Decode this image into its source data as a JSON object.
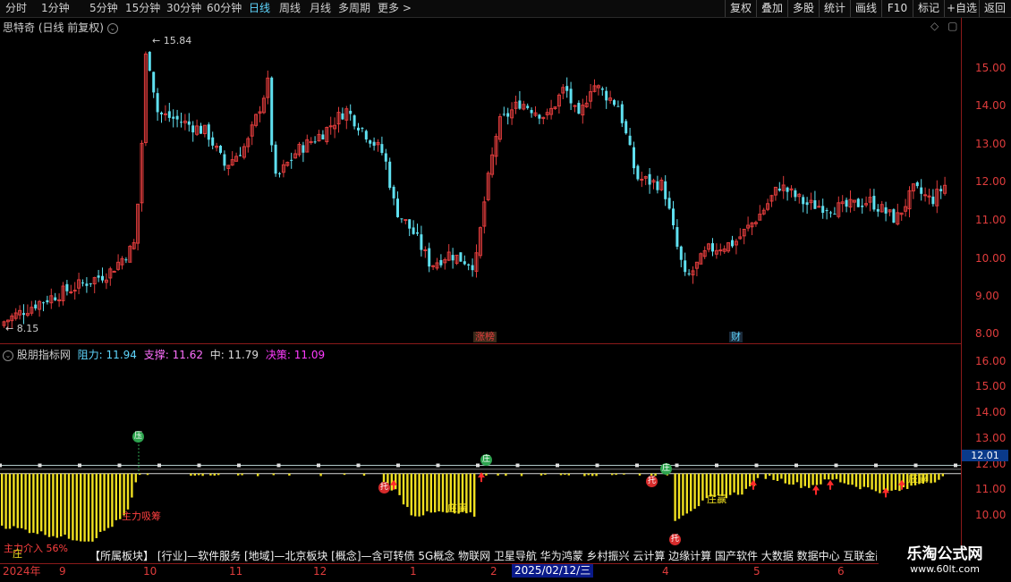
{
  "toolbar": {
    "timeframes": [
      "分时",
      "1分钟",
      "5分钟",
      "15分钟",
      "30分钟",
      "60分钟",
      "日线",
      "周线",
      "月线",
      "多周期",
      "更多 >"
    ],
    "active": "日线",
    "right_buttons": [
      "复权",
      "叠加",
      "多股",
      "统计",
      "画线",
      "F10",
      "标记",
      "+自选",
      "返回"
    ]
  },
  "price_panel": {
    "title": "思特奇 (日线 前复权)",
    "high_label": "15.84",
    "low_label": "8.15",
    "y_ticks": [
      "15.00",
      "14.00",
      "13.00",
      "12.00",
      "11.00",
      "10.00",
      "9.00",
      "8.00"
    ],
    "event_labels": [
      "涨榜",
      "财"
    ]
  },
  "indicator_panel": {
    "name": "股朋指标网",
    "resistance_label": "阻力:",
    "resistance_value": "11.94",
    "support_label": "支撑:",
    "support_value": "11.62",
    "mid_label": "中:",
    "mid_value": "11.79",
    "decision_label": "决策:",
    "decision_value": "11.09",
    "y_ticks": [
      "16.00",
      "15.00",
      "14.00",
      "13.00",
      "12.00",
      "11.00",
      "10.00"
    ],
    "current_price_box": "12.01",
    "annotations": [
      "主力吸筹",
      "庄赢",
      "庄赢",
      "庄赢",
      "主力介入 56%",
      "庄"
    ],
    "chips": [
      "压",
      "庄",
      "庄",
      "托",
      "托",
      "托"
    ]
  },
  "bottom": {
    "info_bar": "【所属板块】 [行业]—软件服务 [地域]—北京板块 [概念]—含可转债 5G概念 物联网 卫星导航 华为鸿蒙 乡村振兴 云计算 边缘计算 国产软件 大数据 数据中心 互联金融 智",
    "date_labels": [
      "2024年",
      "9",
      "10",
      "11",
      "12",
      "1",
      "2",
      "4",
      "5",
      "6"
    ],
    "cursor_date": "2025/02/12/三",
    "watermark_title": "乐淘公式网",
    "watermark_url": "www.60lt.com"
  },
  "colors": {
    "up": "#e03c3c",
    "down": "#5fe0f0",
    "volume_bar": "#f0e020",
    "accent": "#5fd7ff",
    "panel_line": "#8b1a1a"
  }
}
